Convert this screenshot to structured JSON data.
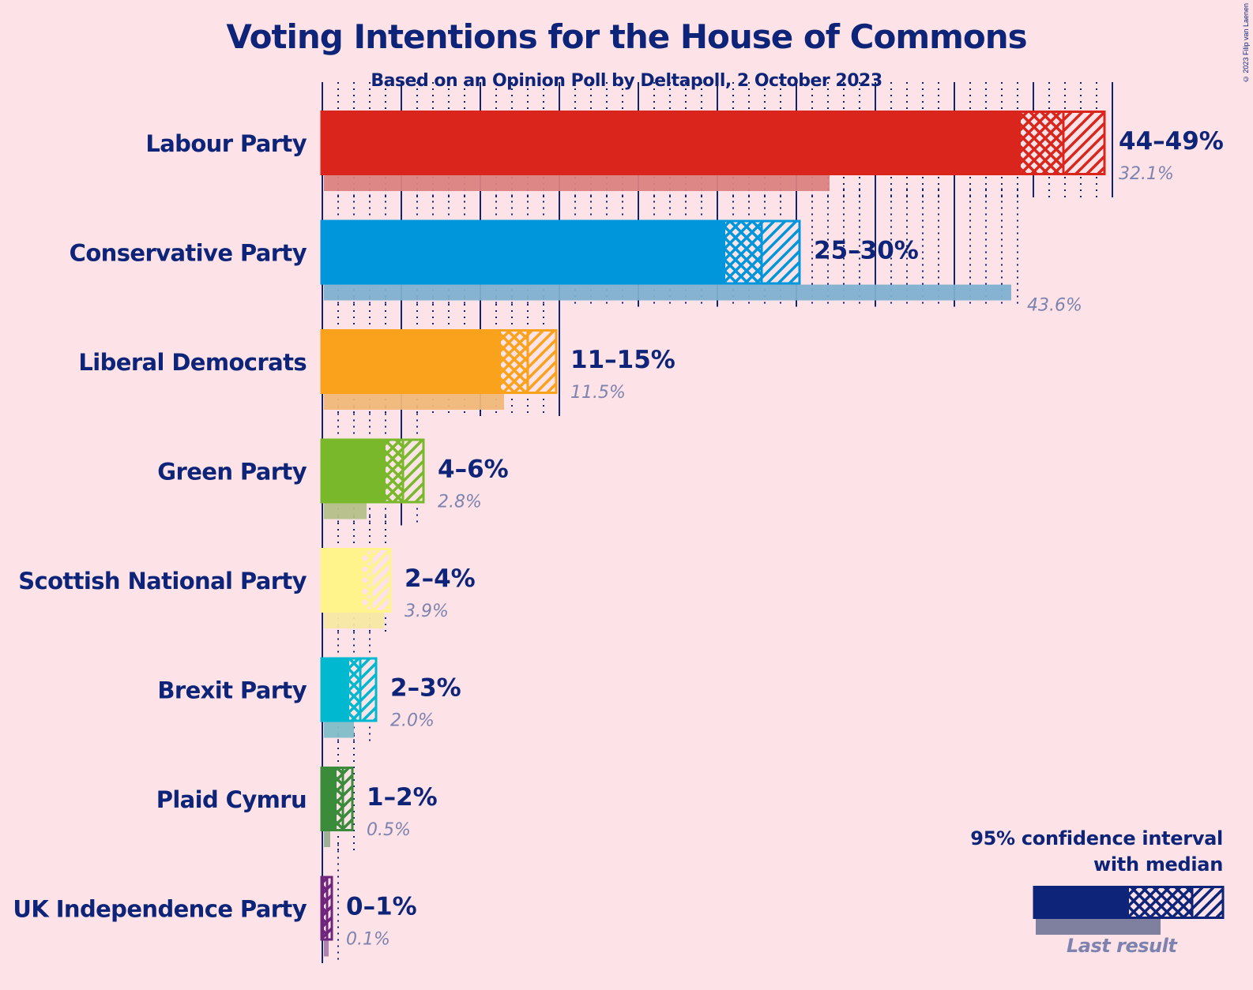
{
  "copyright": "© 2023 Filip van Laenen",
  "chart_data": {
    "type": "bar",
    "title": "Voting Intentions for the House of Commons",
    "subtitle": "Based on an Opinion Poll by Deltapoll, 2 October 2023",
    "xlabel": "",
    "ylabel": "",
    "xlim": [
      0,
      50
    ],
    "grid": {
      "major_step": 5,
      "minor_step": 1
    },
    "categories": [
      "Labour Party",
      "Conservative Party",
      "Liberal Democrats",
      "Green Party",
      "Scottish National Party",
      "Brexit Party",
      "Plaid Cymru",
      "UK Independence Party"
    ],
    "series": [
      {
        "name": "95% confidence interval low",
        "values": [
          44.2,
          25.5,
          11.3,
          4.0,
          2.5,
          1.7,
          0.9,
          0.1
        ]
      },
      {
        "name": "median",
        "values": [
          46.9,
          27.8,
          13.0,
          5.1,
          3.1,
          2.4,
          1.3,
          0.3
        ]
      },
      {
        "name": "95% confidence interval high",
        "values": [
          49.5,
          30.2,
          14.8,
          6.4,
          4.3,
          3.4,
          1.9,
          0.6
        ]
      },
      {
        "name": "Last result",
        "values": [
          32.1,
          43.6,
          11.5,
          2.8,
          3.9,
          2.0,
          0.5,
          0.1
        ]
      }
    ],
    "range_labels": [
      "44–49%",
      "25–30%",
      "11–15%",
      "4–6%",
      "2–4%",
      "2–3%",
      "1–2%",
      "0–1%"
    ],
    "last_labels": [
      "32.1%",
      "43.6%",
      "11.5%",
      "2.8%",
      "3.9%",
      "2.0%",
      "0.5%",
      "0.1%"
    ],
    "colors": [
      "#da251d",
      "#0096db",
      "#faa21b",
      "#78b82a",
      "#fff48c",
      "#00b9d0",
      "#3a8b3a",
      "#70257c"
    ],
    "last_colors": [
      "#dc8282",
      "#80b0d0",
      "#f0b87a",
      "#b5c08a",
      "#f7e8a4",
      "#80bcc8",
      "#9aad90",
      "#a87ea8"
    ],
    "legend": {
      "title_line1": "95% confidence interval",
      "title_line2": "with median",
      "last_result": "Last result",
      "placement": "bottom-right",
      "color": "#0d2478",
      "last_color": "#7f7f9f"
    },
    "axis_color": "#0d2478"
  }
}
